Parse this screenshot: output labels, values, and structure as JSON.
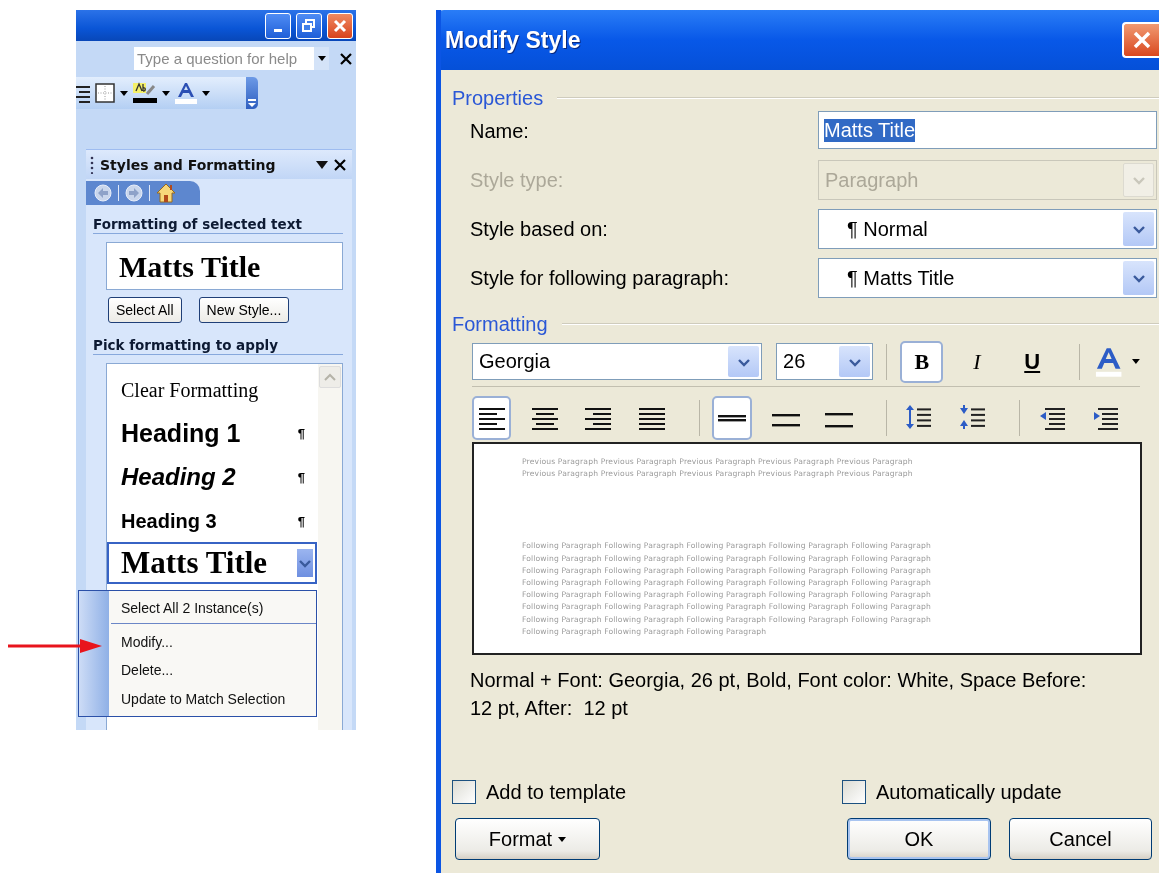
{
  "help_search": {
    "placeholder": "Type a question for help"
  },
  "task_pane": {
    "title": "Styles and Formatting",
    "selected_heading": "Formatting of selected text",
    "selected_style": "Matts Title",
    "buttons": [
      "Select All",
      "New Style..."
    ],
    "pick_heading": "Pick formatting to apply",
    "styles": [
      {
        "label": "Clear Formatting",
        "kind": "clear",
        "selected": false
      },
      {
        "label": "Heading 1",
        "kind": "heading1",
        "mark": "¶",
        "selected": false
      },
      {
        "label": "Heading 2",
        "kind": "heading2",
        "mark": "¶",
        "selected": false
      },
      {
        "label": "Heading 3",
        "kind": "heading3",
        "mark": "¶",
        "selected": false
      },
      {
        "label": "Matts Title",
        "kind": "custom",
        "selected": true
      }
    ]
  },
  "context_menu": {
    "items": [
      {
        "label": "Select All 2 Instance(s)",
        "separator_after": true
      },
      {
        "label": "Modify...",
        "separator_after": false
      },
      {
        "label": "Delete...",
        "separator_after": false
      },
      {
        "label": "Update to Match Selection",
        "separator_after": false
      }
    ]
  },
  "dialog": {
    "title": "Modify Style",
    "properties": {
      "heading": "Properties",
      "fields": [
        {
          "label": "Name:",
          "value": "Matts Title",
          "kind": "text",
          "disabled": false
        },
        {
          "label": "Style type:",
          "value": "Paragraph",
          "kind": "combo",
          "disabled": true
        },
        {
          "label": "Style based on:",
          "value": "¶ Normal",
          "kind": "combo",
          "disabled": false
        },
        {
          "label": "Style for following paragraph:",
          "value": "¶ Matts Title",
          "kind": "combo",
          "disabled": false
        }
      ]
    },
    "formatting": {
      "heading": "Formatting",
      "font": "Georgia",
      "size": "26",
      "style_buttons": [
        {
          "kind": "bold",
          "label": "B",
          "selected": true
        },
        {
          "kind": "italic",
          "label": "I",
          "selected": false
        },
        {
          "kind": "underline",
          "label": "U",
          "selected": false
        }
      ],
      "align_buttons": [
        {
          "kind": "left",
          "selected": true
        },
        {
          "kind": "center",
          "selected": false
        },
        {
          "kind": "right",
          "selected": false
        },
        {
          "kind": "justify",
          "selected": false
        }
      ],
      "spacing_buttons": [
        {
          "kind": "single",
          "selected": true
        },
        {
          "kind": "one-half",
          "selected": false
        },
        {
          "kind": "double",
          "selected": false
        }
      ],
      "paragraph_buttons": [
        {
          "kind": "space-increase"
        },
        {
          "kind": "space-decrease"
        },
        {
          "kind": "indent-decrease"
        },
        {
          "kind": "indent-increase"
        }
      ]
    },
    "preview": {
      "previous_lines": [
        "Previous Paragraph Previous Paragraph Previous Paragraph Previous Paragraph Previous Paragraph",
        "Previous Paragraph Previous Paragraph Previous Paragraph Previous Paragraph Previous Paragraph"
      ],
      "following_lines": [
        "Following Paragraph Following Paragraph Following Paragraph Following Paragraph Following Paragraph",
        "Following Paragraph Following Paragraph Following Paragraph Following Paragraph Following Paragraph",
        "Following Paragraph Following Paragraph Following Paragraph Following Paragraph Following Paragraph",
        "Following Paragraph Following Paragraph Following Paragraph Following Paragraph Following Paragraph",
        "Following Paragraph Following Paragraph Following Paragraph Following Paragraph Following Paragraph",
        "Following Paragraph Following Paragraph Following Paragraph Following Paragraph Following Paragraph",
        "Following Paragraph Following Paragraph Following Paragraph Following Paragraph Following Paragraph",
        "Following Paragraph Following Paragraph Following Paragraph"
      ]
    },
    "description": "Normal + Font: Georgia, 26 pt, Bold, Font color: White, Space Before: 12 pt, After:  12 pt",
    "checkboxes": [
      {
        "label": "Add to template",
        "checked": false
      },
      {
        "label": "Automatically update",
        "checked": false
      }
    ],
    "buttons": [
      {
        "label": "Format",
        "kind": "menu"
      },
      {
        "label": "OK",
        "kind": "default"
      },
      {
        "label": "Cancel",
        "kind": "normal"
      }
    ]
  }
}
